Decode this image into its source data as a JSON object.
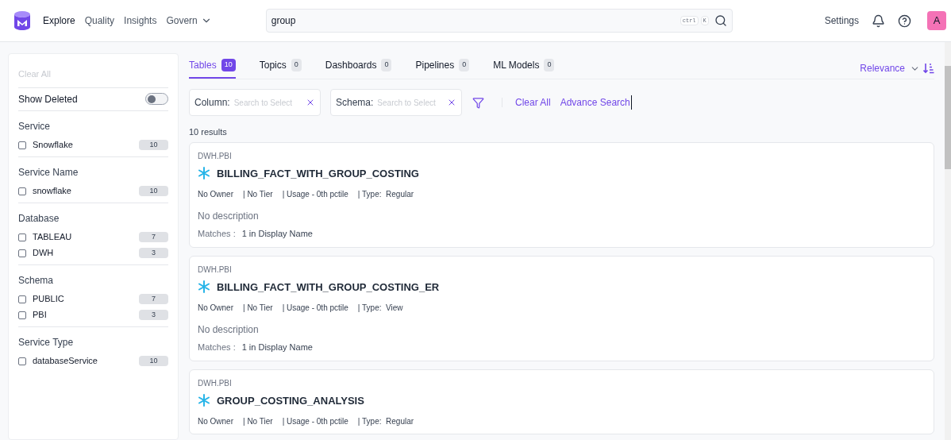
{
  "nav": {
    "items": [
      {
        "label": "Explore",
        "selected": true
      },
      {
        "label": "Quality",
        "selected": false
      },
      {
        "label": "Insights",
        "selected": false
      },
      {
        "label": "Govern",
        "selected": false,
        "dropdown": true
      }
    ],
    "search": {
      "value": "group",
      "shortcut": [
        "ctrl",
        "K"
      ]
    },
    "settings": "Settings",
    "avatar": "A"
  },
  "sidebar": {
    "clear_all": "Clear All",
    "show_deleted": {
      "label": "Show Deleted",
      "on": false
    },
    "groups": [
      {
        "title": "Service",
        "options": [
          {
            "label": "Snowflake",
            "count": "10",
            "checked": false
          }
        ]
      },
      {
        "title": "Service Name",
        "options": [
          {
            "label": "snowflake",
            "count": "10",
            "checked": false
          }
        ]
      },
      {
        "title": "Database",
        "options": [
          {
            "label": "TABLEAU",
            "count": "7",
            "checked": false
          },
          {
            "label": "DWH",
            "count": "3",
            "checked": false
          }
        ]
      },
      {
        "title": "Schema",
        "options": [
          {
            "label": "PUBLIC",
            "count": "7",
            "checked": false
          },
          {
            "label": "PBI",
            "count": "3",
            "checked": false
          }
        ]
      },
      {
        "title": "Service Type",
        "options": [
          {
            "label": "databaseService",
            "count": "10",
            "checked": false
          }
        ]
      }
    ]
  },
  "tabs": [
    {
      "label": "Tables",
      "count": "10",
      "selected": true
    },
    {
      "label": "Topics",
      "count": "0",
      "selected": false
    },
    {
      "label": "Dashboards",
      "count": "0",
      "selected": false
    },
    {
      "label": "Pipelines",
      "count": "0",
      "selected": false
    },
    {
      "label": "ML Models",
      "count": "0",
      "selected": false
    }
  ],
  "sort": {
    "label": "Relevance"
  },
  "filters": [
    {
      "label": "Column:",
      "placeholder": "Search to Select"
    },
    {
      "label": "Schema:",
      "placeholder": "Search to Select"
    }
  ],
  "clear_all": "Clear All",
  "advance_search": "Advance Search",
  "result_count": "10 results",
  "results": [
    {
      "path": "DWH.PBI",
      "name": "BILLING_FACT_WITH_GROUP_COSTING",
      "meta": [
        "No Owner",
        "| No Tier",
        "| Usage - 0th pctile",
        "| Type:  Regular"
      ],
      "description": "No description",
      "matches_label": "Matches :",
      "matches": "1 in Display Name"
    },
    {
      "path": "DWH.PBI",
      "name": "BILLING_FACT_WITH_GROUP_COSTING_ER",
      "meta": [
        "No Owner",
        "| No Tier",
        "| Usage - 0th pctile",
        "| Type:  View"
      ],
      "description": "No description",
      "matches_label": "Matches :",
      "matches": "1 in Display Name"
    },
    {
      "path": "DWH.PBI",
      "name": "GROUP_COSTING_ANALYSIS",
      "meta": [
        "No Owner",
        "| No Tier",
        "| Usage - 0th pctile",
        "| Type:  Regular"
      ]
    }
  ]
}
